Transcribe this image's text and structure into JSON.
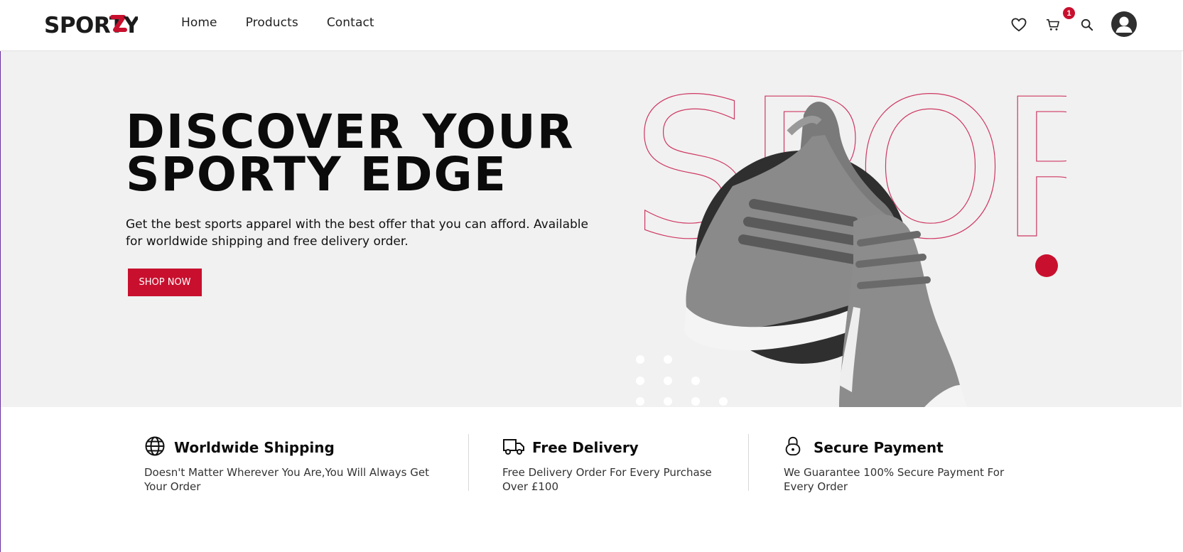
{
  "brand": {
    "logo_text": "SPORTZY"
  },
  "nav": {
    "items": [
      "Home",
      "Products",
      "Contact"
    ]
  },
  "header_icons": {
    "wishlist": "heart-icon",
    "cart": "cart-icon",
    "cart_count": "1",
    "search": "search-icon",
    "account": "user-avatar-icon"
  },
  "hero": {
    "title_line1": "DISCOVER YOUR",
    "title_line2": "SPORTY EDGE",
    "description": "Get the best sports apparel with the best offer that you can afford. Available for worldwide shipping and free delivery order.",
    "cta_label": "SHOP NOW",
    "background_word": "SPORTZY"
  },
  "features": [
    {
      "icon": "globe-icon",
      "title": "Worldwide Shipping",
      "description": "Doesn't Matter Wherever You Are,You Will Always Get Your Order"
    },
    {
      "icon": "truck-icon",
      "title": "Free Delivery",
      "description": "Free Delivery Order For Every Purchase Over £100"
    },
    {
      "icon": "lock-icon",
      "title": "Secure Payment",
      "description": "We Guarantee 100% Secure Payment For Every Order"
    }
  ],
  "colors": {
    "accent": "#c8102e",
    "hero_bg": "#f1f1f1",
    "dark_circle": "#2f2f2f",
    "text": "#0b0b0b"
  }
}
